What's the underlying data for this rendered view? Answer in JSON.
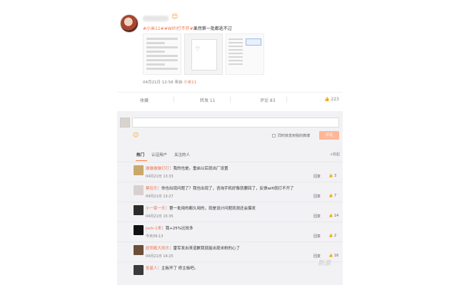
{
  "post": {
    "emoji": "😊",
    "text_tag1": "#小米11#",
    "text_tag2": "#WIFI打不开#",
    "text_rest": "果然第一批都逃不过",
    "time": "04月21日 12:58",
    "from_label": "来自",
    "source": "小米11"
  },
  "actions": {
    "favorite": "收藏",
    "repost": "转发 11",
    "comment": "评论 83",
    "like": "223"
  },
  "composer": {
    "repost_label": "同时转发到我的微博",
    "submit": "评论"
  },
  "filters": {
    "hot": "热门",
    "followed": "认证用户",
    "following": "关注的人",
    "expand": "∧收起"
  },
  "comments": [
    {
      "user": "璇璇璇璇打打",
      "text": "：我的也是。重启以后就出厂设置",
      "time": "04月21日 13:33",
      "reply": "回复",
      "likes": "3"
    },
    {
      "user": "蔡佳乐",
      "text": "：你也出现问题了？我也出现了，咨询手机好像就要回了，反馈wifi就打不开了",
      "time": "04月21日 13:27",
      "reply": "回复",
      "likes": "7"
    },
    {
      "user": "小一家一乐",
      "text": "：第一批用的都久用的，就是设计问题就测还会爆发",
      "time": "04月21日 15:35",
      "reply": "回复",
      "likes": "14"
    },
    {
      "user": "Jack-1来",
      "text": "：我+25%比较多",
      "time": "今天09:13",
      "reply": "回复",
      "likes": "2"
    },
    {
      "user": "欧阳懿大凯乐",
      "text": "：雷军发出来道歉我就能出现米粉的心了",
      "time": "04月21日 14:25",
      "reply": "回复",
      "likes": "16"
    },
    {
      "user": "氪星人",
      "text": "：主板坏了 修主板吧。",
      "time": "",
      "reply": "",
      "likes": ""
    }
  ],
  "watermark": "新浪"
}
